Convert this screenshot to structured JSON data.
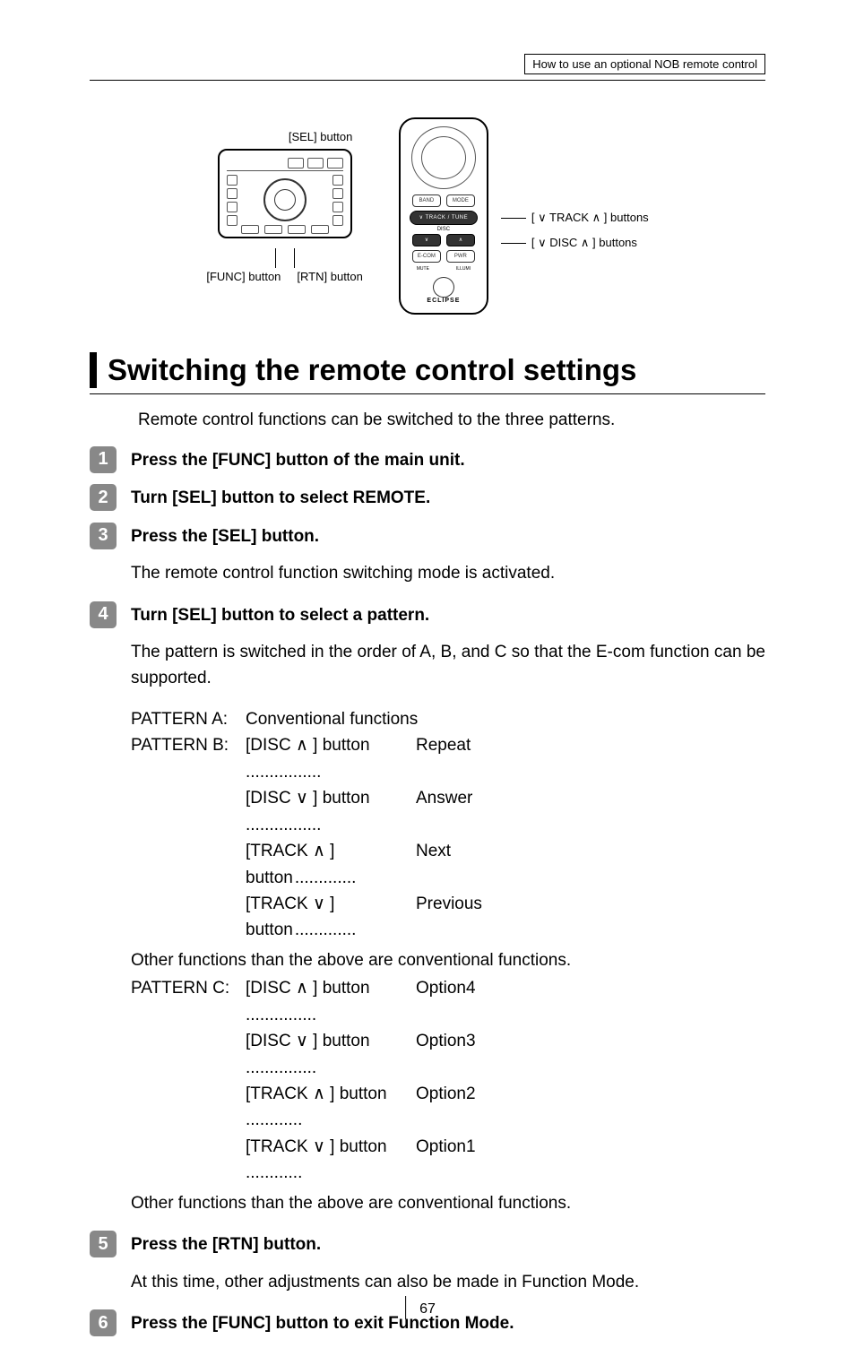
{
  "header": {
    "title": "How to use an optional NOB remote control"
  },
  "diagram": {
    "sel_label": "[SEL] button",
    "func_label": "[FUNC] button",
    "rtn_label": "[RTN] button",
    "remote_band": "BAND",
    "remote_mode": "MODE",
    "remote_track": "TRACK",
    "remote_tuneseek": "TUNE SEEK",
    "remote_disc": "DISC",
    "remote_ecom": "E-COM",
    "remote_pwr": "PWR",
    "remote_mute": "MUTE",
    "remote_illumi": "ILLUMI",
    "remote_brand": "ECLIPSE",
    "track_buttons_label": "[ ∨ TRACK ∧ ] buttons",
    "disc_buttons_label": "[ ∨ DISC ∧ ] buttons"
  },
  "section": {
    "title": "Switching the remote control settings",
    "intro": "Remote control functions can be switched to the three patterns."
  },
  "steps": {
    "s1": {
      "num": "1",
      "title": "Press the [FUNC] button of the main unit."
    },
    "s2": {
      "num": "2",
      "title": "Turn [SEL] button to select REMOTE."
    },
    "s3": {
      "num": "3",
      "title": "Press the [SEL] button.",
      "body": "The remote control function switching mode is activated."
    },
    "s4": {
      "num": "4",
      "title": "Turn [SEL] button to select a pattern.",
      "body": "The pattern is switched in the order of A, B, and C so that the E-com function can be supported."
    },
    "s5": {
      "num": "5",
      "title": "Press the [RTN] button.",
      "body": "At this time, other adjustments can also be made in Function Mode."
    },
    "s6": {
      "num": "6",
      "title": "Press the [FUNC] button to exit Function Mode."
    }
  },
  "patterns": {
    "a_label": "PATTERN A:",
    "a_desc": "Conventional functions",
    "b_label": "PATTERN B:",
    "b_rows": [
      {
        "btn": "[DISC ∧ ] button",
        "action": "Repeat"
      },
      {
        "btn": "[DISC ∨ ] button",
        "action": "Answer"
      },
      {
        "btn": "[TRACK ∧ ] button",
        "action": "Next"
      },
      {
        "btn": "[TRACK ∨ ] button",
        "action": "Previous"
      }
    ],
    "b_other": "Other functions than the above are conventional functions.",
    "c_label": "PATTERN C:",
    "c_rows": [
      {
        "btn": "[DISC ∧ ] button",
        "action": "Option4"
      },
      {
        "btn": "[DISC ∨ ] button",
        "action": "Option3"
      },
      {
        "btn": "[TRACK ∧ ] button",
        "action": "Option2"
      },
      {
        "btn": "[TRACK ∨ ] button",
        "action": "Option1"
      }
    ],
    "c_other": "Other functions than the above are conventional functions."
  },
  "page_number": "67"
}
